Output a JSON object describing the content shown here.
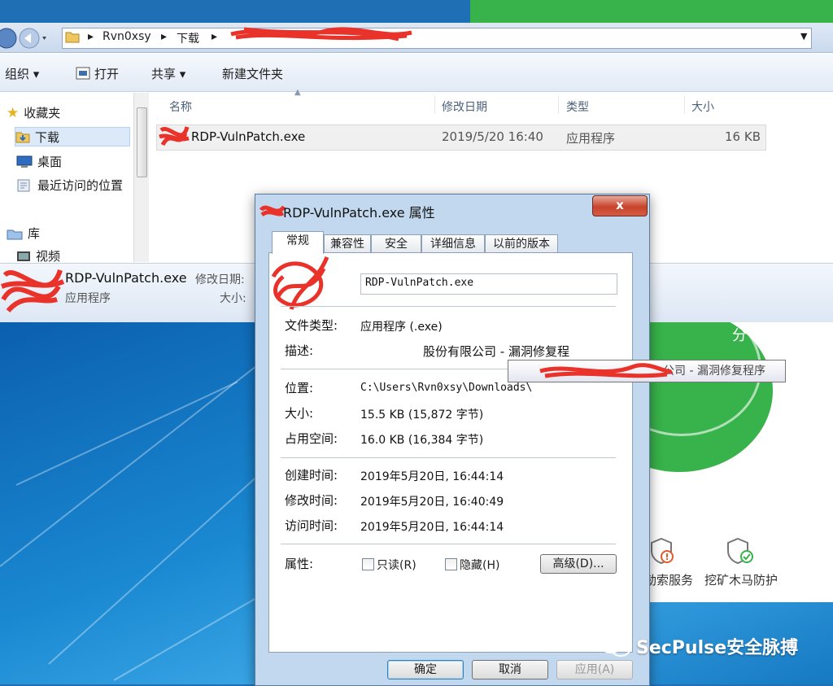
{
  "address": {
    "crumbs": [
      "Rvn0xsy",
      "下载"
    ]
  },
  "toolbar": {
    "organize": "组织 ▾",
    "open": "打开",
    "share": "共享 ▾",
    "new_folder": "新建文件夹"
  },
  "nav": {
    "favorites": "收藏夹",
    "downloads": "下载",
    "desktop": "桌面",
    "recent": "最近访问的位置",
    "library": "库",
    "videos": "视频"
  },
  "file_list": {
    "columns": [
      "名称",
      "修改日期",
      "类型",
      "大小"
    ],
    "row": {
      "name": "RDP-VulnPatch.exe",
      "date": "2019/5/20 16:40",
      "type": "应用程序",
      "size": "16 KB"
    }
  },
  "details_pane": {
    "name": "RDP-VulnPatch.exe",
    "type": "应用程序",
    "mod_label": "修改日期:",
    "size_label": "大小:"
  },
  "dialog": {
    "title": "RDP-VulnPatch.exe 属性",
    "close": "x",
    "tabs": [
      "常规",
      "兼容性",
      "安全",
      "详细信息",
      "以前的版本"
    ],
    "filename": "RDP-VulnPatch.exe",
    "labels": {
      "filetype": "文件类型:",
      "desc": "描述:",
      "location": "位置:",
      "size": "大小:",
      "disk": "占用空间:",
      "created": "创建时间:",
      "modified": "修改时间:",
      "accessed": "访问时间:",
      "attrs": "属性:"
    },
    "values": {
      "filetype": "应用程序 (.exe)",
      "desc": "股份有限公司 - 漏洞修复程",
      "location": "C:\\Users\\Rvn0xsy\\Downloads\\",
      "size": "15.5 KB (15,872 字节)",
      "disk": "16.0 KB (16,384 字节)",
      "created": "2019年5月20日, 16:44:14",
      "modified": "2019年5月20日, 16:40:49",
      "accessed": "2019年5月20日, 16:44:14"
    },
    "readonly": "只读(R)",
    "hidden": "隐藏(H)",
    "advanced": "高级(D)...",
    "ok": "确定",
    "cancel": "取消",
    "apply": "应用(A)"
  },
  "tooltip": "公司 - 漏洞修复程序",
  "security_app": {
    "score_unit": "分",
    "ransom": "勒索服务",
    "mining": "挖矿木马防护"
  },
  "watermark": "SecPulse安全脉搏"
}
